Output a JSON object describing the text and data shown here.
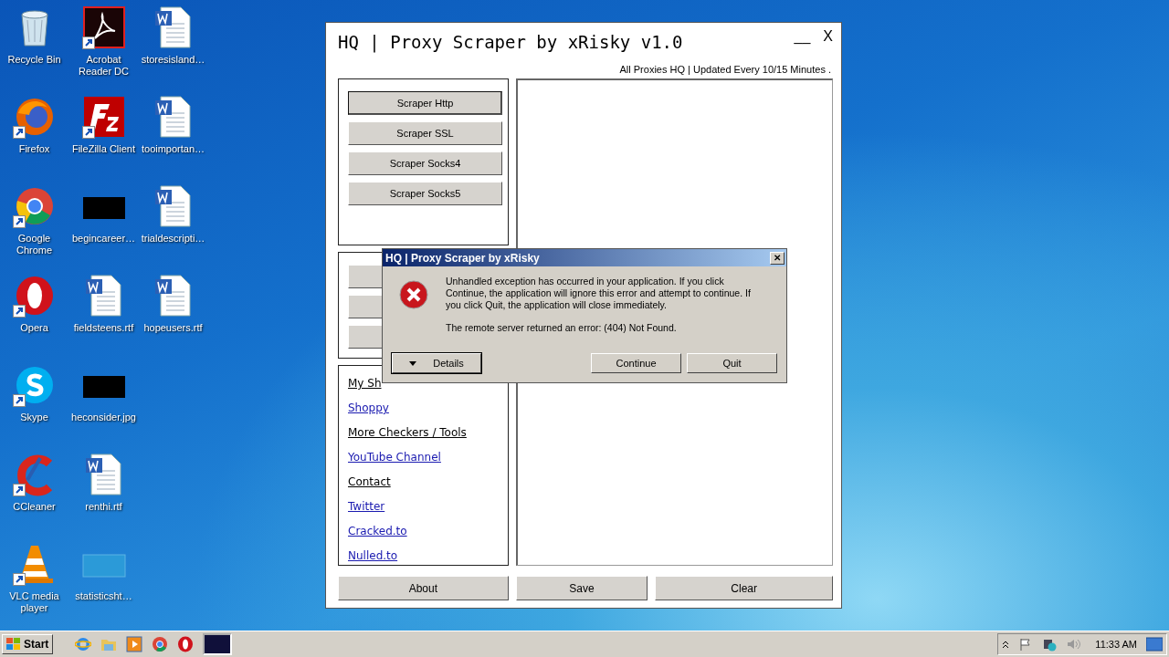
{
  "desktop": {
    "columns": [
      [
        {
          "label": "Recycle Bin",
          "kind": "recycle",
          "shortcut": false
        },
        {
          "label": "Firefox",
          "kind": "firefox",
          "shortcut": true
        },
        {
          "label": "Google Chrome",
          "kind": "chrome",
          "shortcut": true
        },
        {
          "label": "Opera",
          "kind": "opera",
          "shortcut": true
        },
        {
          "label": "Skype",
          "kind": "skype",
          "shortcut": true
        },
        {
          "label": "CCleaner",
          "kind": "ccleaner",
          "shortcut": true
        },
        {
          "label": "VLC media player",
          "kind": "vlc",
          "shortcut": true
        }
      ],
      [
        {
          "label": "Acrobat Reader DC",
          "kind": "acrobat",
          "shortcut": true
        },
        {
          "label": "FileZilla Client",
          "kind": "filezilla",
          "shortcut": true
        },
        {
          "label": "begincareer…",
          "kind": "dark-image",
          "shortcut": false
        },
        {
          "label": "fieldsteens.rtf",
          "kind": "document",
          "shortcut": false
        },
        {
          "label": "heconsider.jpg",
          "kind": "dark-image",
          "shortcut": false
        },
        {
          "label": "renthi.rtf",
          "kind": "document",
          "shortcut": false
        },
        {
          "label": "statisticsht…",
          "kind": "blank-image",
          "shortcut": false
        }
      ],
      [
        {
          "label": "storesisland…",
          "kind": "document",
          "shortcut": false
        },
        {
          "label": "tooimportan…",
          "kind": "document",
          "shortcut": false
        },
        {
          "label": "trialdescripti…",
          "kind": "document",
          "shortcut": false
        },
        {
          "label": "hopeusers.rtf",
          "kind": "document",
          "shortcut": false
        }
      ]
    ]
  },
  "window": {
    "title": "HQ | Proxy Scraper by xRisky v1.0",
    "minimize": "__",
    "close": "X",
    "subtitle": "All Proxies HQ | Updated Every 10/15 Minutes .",
    "scraper_buttons": [
      {
        "label": "Scraper Http",
        "focused": true
      },
      {
        "label": "Scraper SSL",
        "focused": false
      },
      {
        "label": "Scraper Socks4",
        "focused": false
      },
      {
        "label": "Scraper Socks5",
        "focused": false
      }
    ],
    "links": [
      {
        "label": "My Sh",
        "kind": "label"
      },
      {
        "label": "Shoppy",
        "kind": "link"
      },
      {
        "label": "More Checkers / Tools",
        "kind": "label"
      },
      {
        "label": "YouTube Channel",
        "kind": "link"
      },
      {
        "label": "Contact",
        "kind": "label"
      },
      {
        "label": "Twitter",
        "kind": "link"
      },
      {
        "label": "Cracked.to",
        "kind": "link"
      },
      {
        "label": "Nulled.to",
        "kind": "link"
      }
    ],
    "bottom_buttons": [
      "About",
      "Save",
      "Clear"
    ]
  },
  "dialog": {
    "title": "HQ | Proxy Scraper by xRisky",
    "close": "✕",
    "message": "Unhandled exception has occurred in your application. If you click Continue, the application will ignore this error and attempt to continue. If you click Quit, the application will close immediately.",
    "error": "The remote server returned an error: (404) Not Found.",
    "details_button": "Details",
    "buttons": [
      "Continue",
      "Quit"
    ]
  },
  "taskbar": {
    "start": "Start",
    "quick_launch": [
      {
        "kind": "ie"
      },
      {
        "kind": "folder"
      },
      {
        "kind": "media"
      },
      {
        "kind": "chrome"
      },
      {
        "kind": "opera"
      }
    ],
    "clock": "11:33 AM"
  }
}
